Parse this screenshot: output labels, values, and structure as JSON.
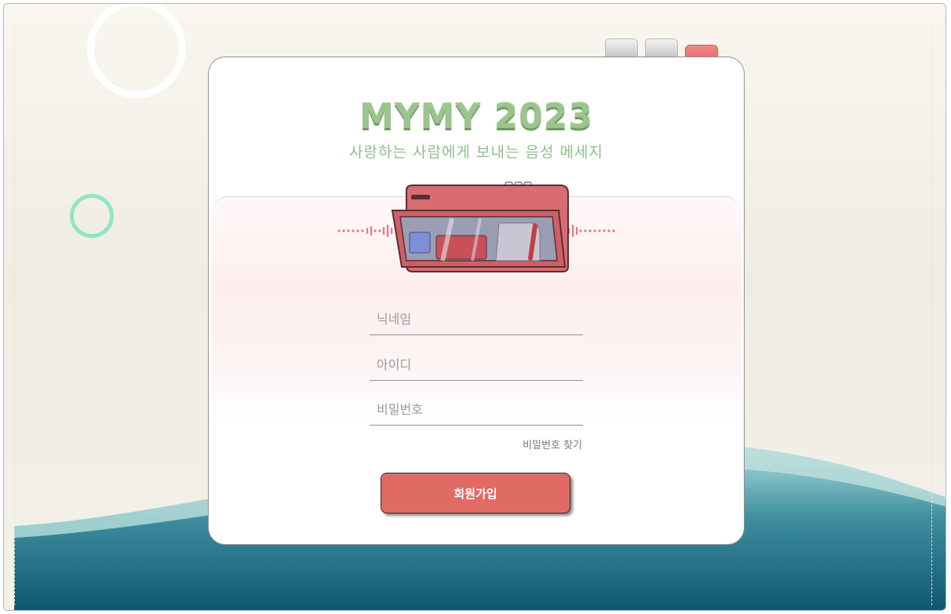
{
  "window": {
    "controls": {
      "minimize_icon": "minimize-icon",
      "maximize_icon": "maximize-icon",
      "close_icon": "close-icon"
    }
  },
  "card": {
    "logo_text": "MYMY 2023",
    "subtitle": "사랑하는 사람에게 보내는 음성 메세지",
    "illustration": "cassette-player-icon",
    "fields": {
      "nickname_placeholder": "닉네임",
      "id_placeholder": "아이디",
      "password_placeholder": "비밀번호"
    },
    "find_password_label": "비밀번호 찾기",
    "signup_label": "회원가입"
  },
  "colors": {
    "accent": "#e06a64",
    "logo_green": "#9cc48e",
    "wave_teal": "#1f6f84",
    "ring_mint": "#8ee6c6"
  }
}
